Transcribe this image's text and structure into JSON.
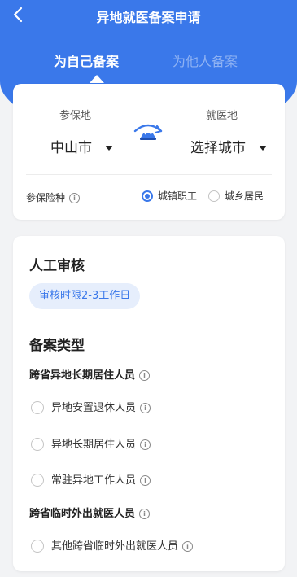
{
  "header": {
    "back_icon": "chevron-left-icon",
    "title": "异地就医备案申请",
    "tabs": [
      {
        "label": "为自己备案",
        "active": true
      },
      {
        "label": "为他人备案",
        "active": false
      }
    ]
  },
  "location_card": {
    "insured_label": "参保地",
    "insured_value": "中山市",
    "treatment_label": "就医地",
    "treatment_value": "选择城市",
    "swap_icon": "swap-location-icon",
    "insurance_type_label": "参保险种",
    "insurance_options": [
      {
        "label": "城镇职工",
        "checked": true
      },
      {
        "label": "城乡居民",
        "checked": false
      }
    ]
  },
  "review_card": {
    "title": "人工审核",
    "review_time": "审核时限2-3工作日",
    "filing_type_title": "备案类型",
    "groups": [
      {
        "title": "跨省异地长期居住人员",
        "options": [
          "异地安置退休人员",
          "异地长期居住人员",
          "常驻异地工作人员"
        ]
      },
      {
        "title": "跨省临时外出就医人员",
        "options": [
          "其他跨省临时外出就医人员"
        ]
      }
    ]
  },
  "colors": {
    "primary": "#3a78ea",
    "chip_bg": "#e6eefc",
    "page_bg": "#f2f3f5"
  }
}
